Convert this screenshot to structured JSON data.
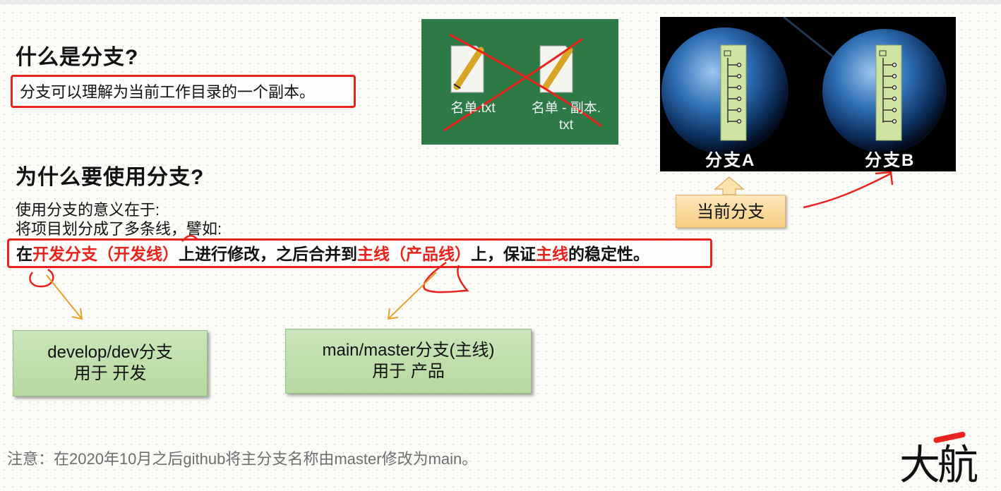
{
  "section1": {
    "heading": "什么是分支?",
    "definition": "分支可以理解为当前工作目录的一个副本。"
  },
  "section2": {
    "heading": "为什么要使用分支?",
    "line1": "使用分支的意义在于:",
    "line2": "将项目划分成了多条线，譬如:",
    "highlight": {
      "p1": "在",
      "p2": "开发分支（开发线）",
      "p3": "上进行修改，之后合并到",
      "p4": "主线（产品线）",
      "p5": "上，保证",
      "p6": "主线",
      "p7": "的稳定性。"
    }
  },
  "files_image": {
    "file1": "名单.txt",
    "file2_line1": "名单 - 副本.",
    "file2_line2": "txt"
  },
  "earth_image": {
    "label_a": "分支A",
    "label_b": "分支B"
  },
  "current_branch": "当前分支",
  "boxes": {
    "dev_line1": "develop/dev分支",
    "dev_line2": "用于 开发",
    "main_line1": "main/master分支(主线)",
    "main_line2": "用于 产品"
  },
  "note": "注意：在2020年10月之后github将主分支名称由master修改为main。",
  "logo": "大航",
  "colors": {
    "accent": "#e8231d",
    "green_box": "#c2e2b0",
    "orange_box": "#f9d690"
  }
}
